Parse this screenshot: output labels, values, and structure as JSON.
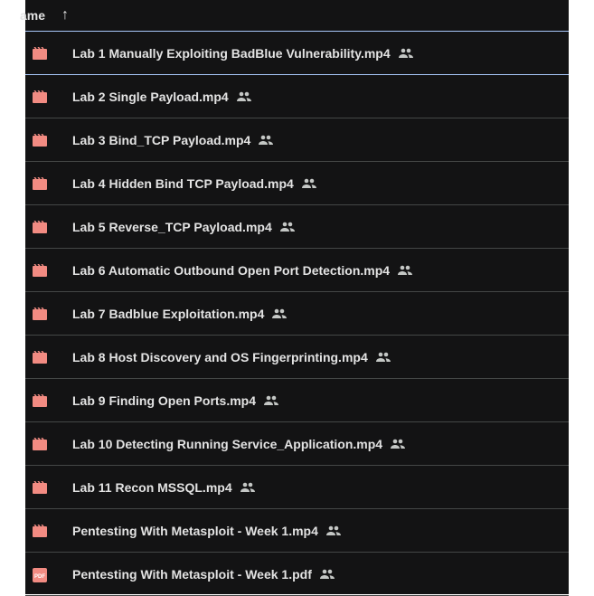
{
  "header": {
    "column_name": "ame",
    "sort_icon": "arrow-up-icon"
  },
  "colors": {
    "video": "#f28b82",
    "pdf": "#f28b82",
    "background": "#131314",
    "selected_border": "#a8c7fa"
  },
  "files": [
    {
      "name": "Lab 1 Manually Exploiting BadBlue Vulnerability.mp4",
      "type": "video"
    },
    {
      "name": "Lab 2 Single Payload.mp4",
      "type": "video"
    },
    {
      "name": "Lab 3 Bind_TCP Payload.mp4",
      "type": "video"
    },
    {
      "name": "Lab 4 Hidden Bind TCP Payload.mp4",
      "type": "video"
    },
    {
      "name": "Lab 5 Reverse_TCP Payload.mp4",
      "type": "video"
    },
    {
      "name": "Lab 6 Automatic Outbound Open Port Detection.mp4",
      "type": "video"
    },
    {
      "name": "Lab 7 Badblue Exploitation.mp4",
      "type": "video"
    },
    {
      "name": "Lab 8 Host Discovery and OS Fingerprinting.mp4",
      "type": "video"
    },
    {
      "name": "Lab 9 Finding Open Ports.mp4",
      "type": "video"
    },
    {
      "name": "Lab 10 Detecting Running Service_Application.mp4",
      "type": "video"
    },
    {
      "name": "Lab 11 Recon MSSQL.mp4",
      "type": "video"
    },
    {
      "name": "Pentesting With Metasploit - Week 1.mp4",
      "type": "video"
    },
    {
      "name": "Pentesting With Metasploit - Week 1.pdf",
      "type": "pdf",
      "icon_text": "PDF"
    }
  ]
}
